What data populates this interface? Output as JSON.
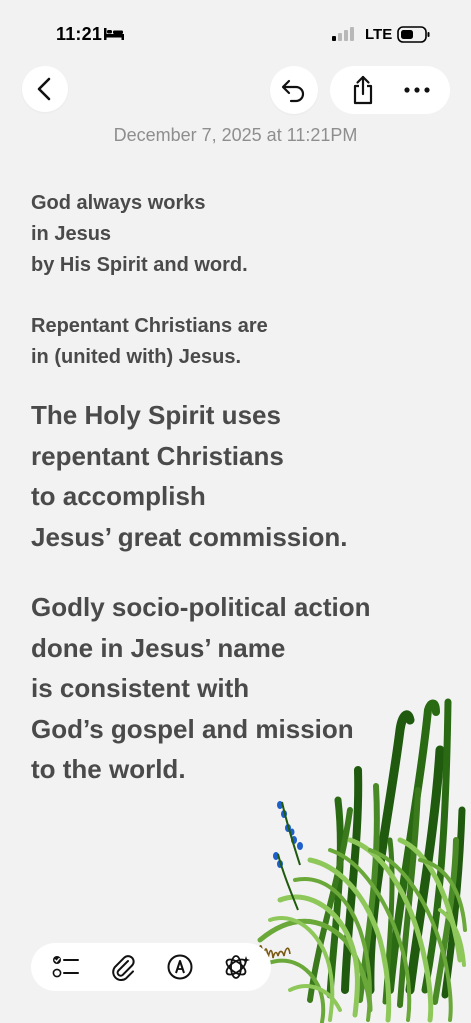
{
  "status_bar": {
    "time": "11:21",
    "network": "LTE",
    "icons": [
      "bed-icon",
      "cellular-signal-icon",
      "battery-icon"
    ]
  },
  "toolbar": {
    "icons": [
      "chevron-left-icon",
      "undo-icon",
      "share-icon",
      "more-icon"
    ]
  },
  "note": {
    "date": "December 7, 2025 at 11:21PM",
    "paragraphs": [
      "God always works\nin Jesus\nby His Spirit and word.",
      "Repentant Christians are\nin (united with) Jesus.",
      "The Holy Spirit uses\nrepentant Christians\nto accomplish\nJesus’ great commission.",
      "Godly socio-political action\ndone in Jesus’ name\nis consistent with\nGod’s gospel and mission\nto the world."
    ]
  },
  "drawing": {
    "description_icon": "grass-sketch",
    "colors": [
      "#1f5a0e",
      "#3b7a1c",
      "#6aa83a",
      "#8fc85a",
      "#1e5fc9"
    ]
  },
  "bottom_toolbar": {
    "icons": [
      "checklist-icon",
      "paperclip-icon",
      "markup-pen-icon",
      "ai-sparkle-icon"
    ]
  }
}
